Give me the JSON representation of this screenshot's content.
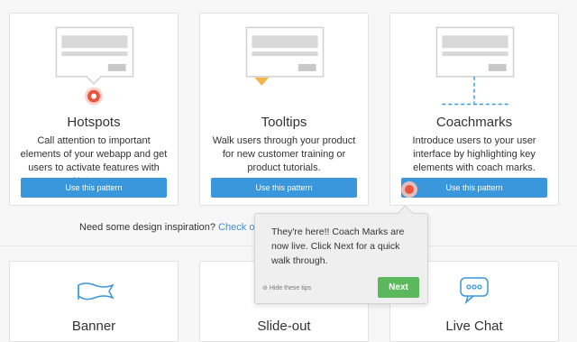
{
  "cards": [
    {
      "title": "Hotspots",
      "description": "Call attention to important elements of your webapp and get users to activate features with Hotspots.",
      "button": "Use this pattern"
    },
    {
      "title": "Tooltips",
      "description": "Walk users through your product for new customer training or product tutorials.",
      "button": "Use this pattern"
    },
    {
      "title": "Coachmarks",
      "description": "Introduce users to your user interface by highlighting key elements with coach marks.",
      "button": "Use this pattern"
    }
  ],
  "inspiration": {
    "text": "Need some design inspiration?",
    "link": "Check out ou"
  },
  "bottom_cards": [
    {
      "title": "Banner",
      "icon": "banner-ribbon-icon"
    },
    {
      "title": "Slide-out",
      "icon": ""
    },
    {
      "title": "Live Chat",
      "icon": "chat-bubble-icon"
    }
  ],
  "popover": {
    "message": "They're here!! Coach Marks are now live. Click Next for a quick walk through.",
    "hide_label": "Hide these tips",
    "next_label": "Next"
  },
  "colors": {
    "accent": "#3a97dc",
    "success": "#5cb85c",
    "hotspot": "#e9553f",
    "tooltip": "#f2b44b"
  }
}
